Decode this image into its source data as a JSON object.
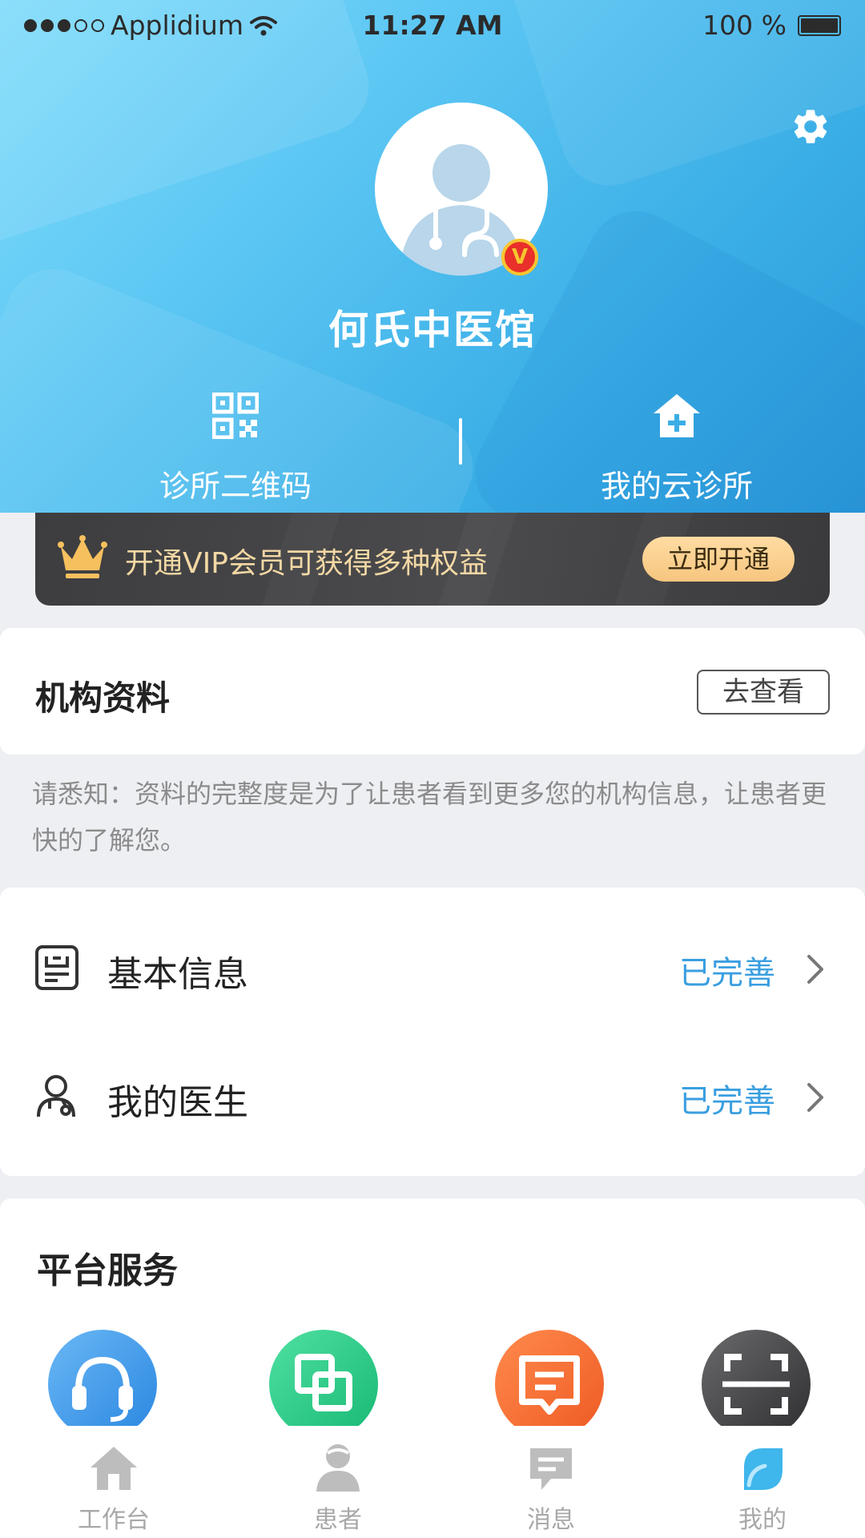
{
  "status_bar": {
    "carrier": "Applidium",
    "time": "11:27 AM",
    "battery": "100 %"
  },
  "header": {
    "clinic_name": "何氏中医馆",
    "badge_letter": "V",
    "qr_label": "诊所二维码",
    "cloud_label": "我的云诊所"
  },
  "vip": {
    "text": "开通VIP会员可获得多种权益",
    "button": "立即开通"
  },
  "org": {
    "title": "机构资料",
    "view_button": "去查看",
    "note": "请悉知：资料的完整度是为了让患者看到更多您的机构信息，让患者更快的了解您。"
  },
  "info_rows": [
    {
      "label": "基本信息",
      "status": "已完善"
    },
    {
      "label": "我的医生",
      "status": "已完善"
    }
  ],
  "services": {
    "title": "平台服务"
  },
  "tabs": [
    {
      "label": "工作台"
    },
    {
      "label": "患者"
    },
    {
      "label": "消息"
    },
    {
      "label": "我的"
    }
  ],
  "colors": {
    "accent": "#3a9ee0",
    "vip_text": "#f3d8a4",
    "header_blue": "#3aaee6"
  }
}
